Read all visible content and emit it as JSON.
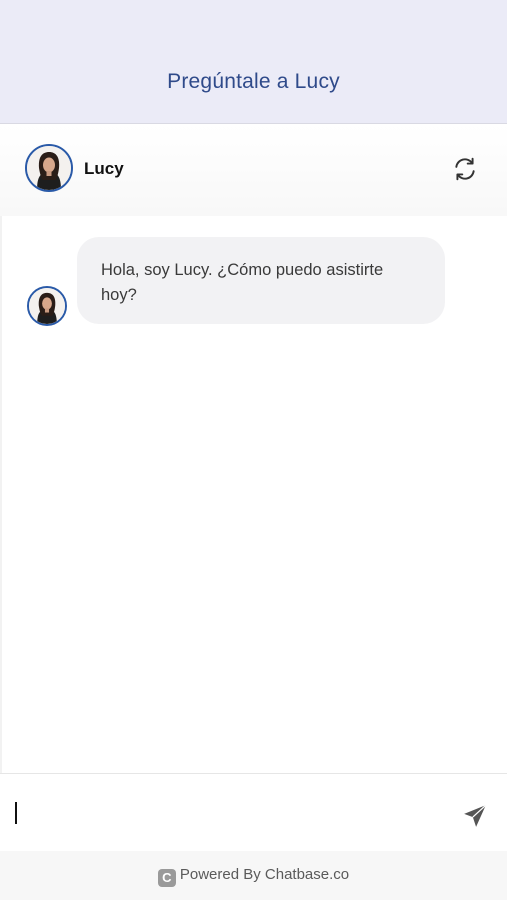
{
  "topbar": {
    "title": "Pregúntale a Lucy"
  },
  "chat_header": {
    "bot_name": "Lucy"
  },
  "messages": [
    {
      "sender": "bot",
      "text": "Hola, soy Lucy. ¿Cómo puedo asistirte hoy?"
    }
  ],
  "input": {
    "value": "",
    "placeholder": ""
  },
  "footer": {
    "logo_letter": "C",
    "powered_by": "Powered By Chatbase.co"
  },
  "icons": {
    "refresh": "refresh-icon",
    "send": "send-icon"
  },
  "colors": {
    "header_bg": "#ebebf7",
    "title": "#2f4a8a",
    "avatar_ring": "#2a5aa8",
    "bubble_bg": "#f2f2f4"
  }
}
